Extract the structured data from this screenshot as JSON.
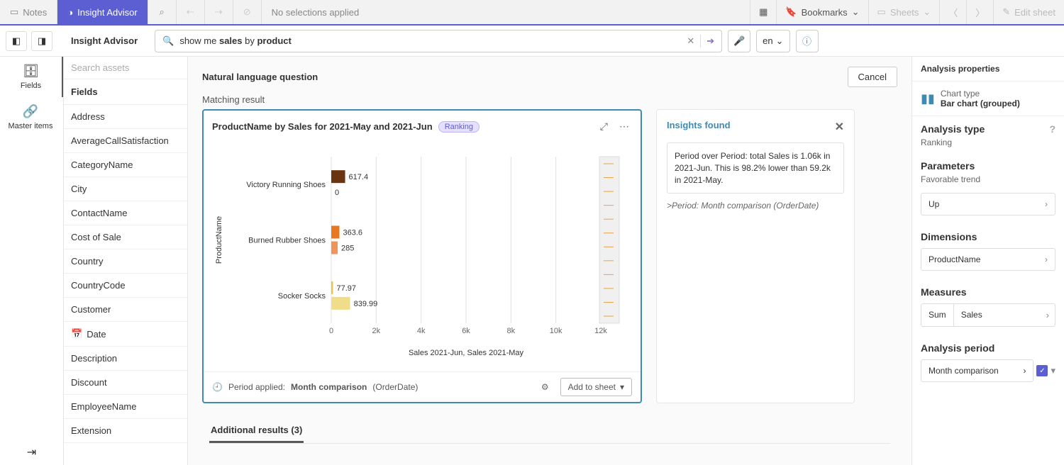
{
  "topbar": {
    "notes_label": "Notes",
    "insight_label": "Insight Advisor",
    "no_selections": "No selections applied",
    "bookmarks_label": "Bookmarks",
    "sheets_label": "Sheets",
    "edit_sheet_label": "Edit sheet"
  },
  "subbar": {
    "title": "Insight Advisor",
    "search_pre": "show me ",
    "search_kw1": "sales",
    "search_mid": " by ",
    "search_kw2": "product",
    "lang": "en"
  },
  "leftrail": {
    "fields": "Fields",
    "master": "Master items"
  },
  "fieldspanel": {
    "search_placeholder": "Search assets",
    "section": "Fields",
    "items": [
      "Address",
      "AverageCallSatisfaction",
      "CategoryName",
      "City",
      "ContactName",
      "Cost of Sale",
      "Country",
      "CountryCode",
      "Customer",
      "Date",
      "Description",
      "Discount",
      "EmployeeName",
      "Extension"
    ]
  },
  "center": {
    "nlq_title": "Natural language question",
    "cancel": "Cancel",
    "matching": "Matching result",
    "chart_title": "ProductName by Sales for 2021-May and 2021-Jun",
    "badge": "Ranking",
    "period_applied_label": "Period applied:",
    "period_applied_value": "Month comparison",
    "period_applied_extra": "(OrderDate)",
    "add_to_sheet": "Add to sheet",
    "insights_title": "Insights found",
    "insight_text": "Period over Period: total Sales is 1.06k in 2021-Jun. This is 98.2% lower than 59.2k in 2021-May.",
    "insight_note": ">Period: Month comparison (OrderDate)",
    "additional_label": "Additional results (3)"
  },
  "rightpanel": {
    "header": "Analysis properties",
    "chart_type_label": "Chart type",
    "chart_type_value": "Bar chart (grouped)",
    "analysis_type_label": "Analysis type",
    "analysis_type_value": "Ranking",
    "parameters_label": "Parameters",
    "favorable_trend_label": "Favorable trend",
    "favorable_trend_value": "Up",
    "dimensions_label": "Dimensions",
    "dimension_value": "ProductName",
    "measures_label": "Measures",
    "measure_agg": "Sum",
    "measure_name": "Sales",
    "analysis_period_label": "Analysis period",
    "analysis_period_value": "Month comparison"
  },
  "chart_data": {
    "type": "bar",
    "orientation": "horizontal",
    "title": "ProductName by Sales for 2021-May and 2021-Jun",
    "ylabel": "ProductName",
    "xlabel": "Sales 2021-Jun, Sales 2021-May",
    "xlim": [
      0,
      12000
    ],
    "xticks": [
      0,
      2000,
      4000,
      6000,
      8000,
      10000,
      12000
    ],
    "xtick_labels": [
      "0",
      "2k",
      "4k",
      "6k",
      "8k",
      "10k",
      "12k"
    ],
    "categories": [
      "Victory Running Shoes",
      "Burned Rubber Shoes",
      "Socker Socks"
    ],
    "series": [
      {
        "name": "Sales 2021-Jun",
        "color": "#7B3F00",
        "values": [
          617.4,
          363.6,
          77.97
        ]
      },
      {
        "name": "Sales 2021-May",
        "color": "#E8A33D",
        "values": [
          0,
          285,
          839.99
        ]
      }
    ]
  }
}
